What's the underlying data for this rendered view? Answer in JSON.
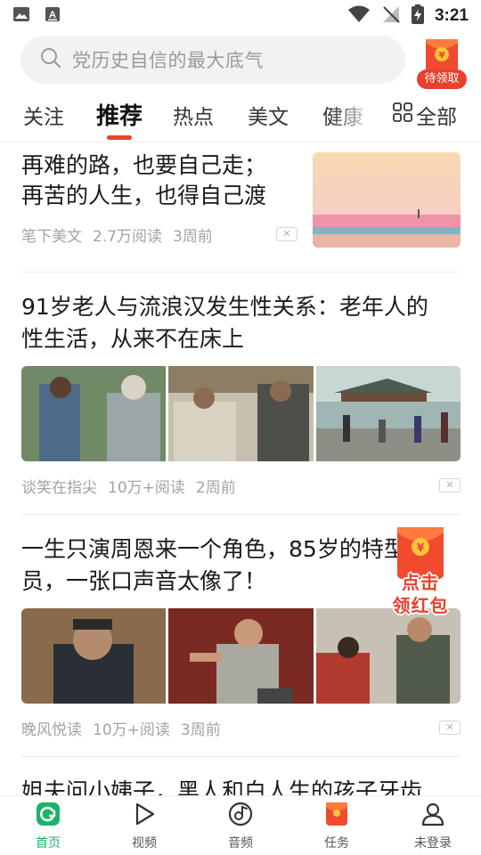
{
  "status_bar": {
    "time": "3:21"
  },
  "search": {
    "placeholder": "党历史自信的最大底气"
  },
  "redpack": {
    "label": "待领取",
    "coin": "¥"
  },
  "tabs": [
    {
      "label": "关注"
    },
    {
      "label": "推荐",
      "active": true
    },
    {
      "label": "热点"
    },
    {
      "label": "美文"
    },
    {
      "label": "健康"
    }
  ],
  "tab_all": {
    "label": "全部"
  },
  "articles": [
    {
      "title_line1": "再难的路，也要自己走；",
      "title_line2": "再苦的人生，也得自己渡",
      "source": "笔下美文",
      "reads": "2.7万阅读",
      "time": "3周前"
    },
    {
      "title_line1": "91岁老人与流浪汉发生性关系：老年人的",
      "title_line2": "性生活，从来不在床上",
      "source": "谈笑在指尖",
      "reads": "10万+阅读",
      "time": "2周前"
    },
    {
      "title_line1": "一生只演周恩来一个角色，85岁的特型演",
      "title_line2": "员，一张口声音太像了！",
      "source": "晚风悦读",
      "reads": "10万+阅读",
      "time": "3周前"
    },
    {
      "title_line1": "姐夫问小姨子，黑人和白人生的孩子牙齿"
    }
  ],
  "float_redpack": {
    "line1": "点击",
    "line2": "领红包",
    "coin": "¥"
  },
  "bottom_nav": [
    {
      "label": "首页",
      "icon": "home-refresh-icon",
      "active": true
    },
    {
      "label": "视频",
      "icon": "play-icon"
    },
    {
      "label": "音频",
      "icon": "audio-disc-icon"
    },
    {
      "label": "任务",
      "icon": "task-redpack-icon"
    },
    {
      "label": "未登录",
      "icon": "user-icon"
    }
  ],
  "colors": {
    "accent": "#e8412e",
    "nav_active": "#1ab36a"
  }
}
